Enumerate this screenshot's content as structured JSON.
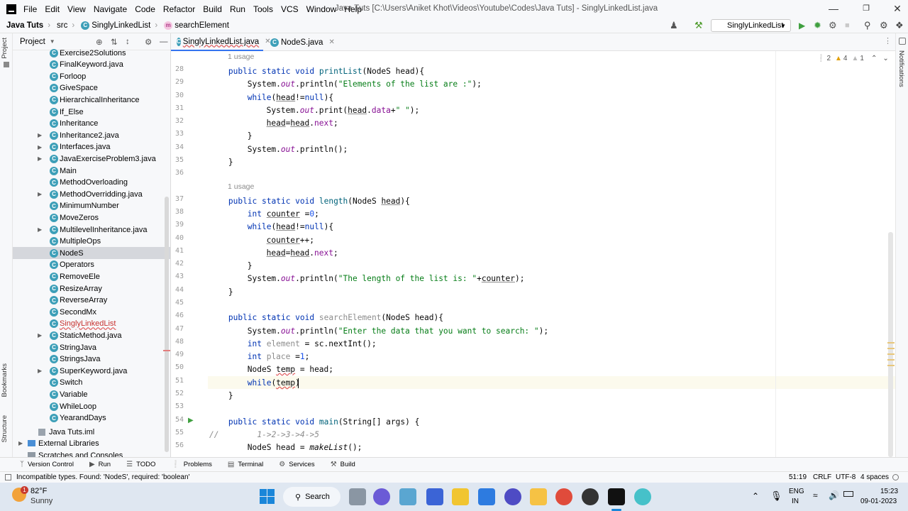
{
  "menubar": {
    "items": [
      "File",
      "Edit",
      "View",
      "Navigate",
      "Code",
      "Refactor",
      "Build",
      "Run",
      "Tools",
      "VCS",
      "Window",
      "Help"
    ],
    "title": "Java Tuts [C:\\Users\\Aniket Khot\\Videos\\Youtube\\Codes\\Java Tuts] - SinglyLinkedList.java"
  },
  "navbar": {
    "project": "Java Tuts",
    "src": "src",
    "cls": "SinglyLinkedList",
    "method": "searchElement",
    "run_config": "SinglyLinkedList"
  },
  "project_panel": {
    "title": "Project",
    "items": [
      {
        "name": "Exercise2Solutions",
        "arrow": false
      },
      {
        "name": "FinalKeyword.java",
        "arrow": false
      },
      {
        "name": "Forloop",
        "arrow": false
      },
      {
        "name": "GiveSpace",
        "arrow": false
      },
      {
        "name": "HierarchicalInheritance",
        "arrow": false
      },
      {
        "name": "If_Else",
        "arrow": false
      },
      {
        "name": "Inheritance",
        "arrow": false
      },
      {
        "name": "Inheritance2.java",
        "arrow": true
      },
      {
        "name": "Interfaces.java",
        "arrow": true
      },
      {
        "name": "JavaExerciseProblem3.java",
        "arrow": true
      },
      {
        "name": "Main",
        "arrow": false
      },
      {
        "name": "MethodOverloading",
        "arrow": false
      },
      {
        "name": "MethodOverridding.java",
        "arrow": true
      },
      {
        "name": "MinimumNumber",
        "arrow": false
      },
      {
        "name": "MoveZeros",
        "arrow": false
      },
      {
        "name": "MultilevelInheritance.java",
        "arrow": true
      },
      {
        "name": "MultipleOps",
        "arrow": false
      },
      {
        "name": "NodeS",
        "arrow": false,
        "selected": true
      },
      {
        "name": "Operators",
        "arrow": false
      },
      {
        "name": "RemoveEle",
        "arrow": false
      },
      {
        "name": "ResizeArray",
        "arrow": false
      },
      {
        "name": "ReverseArray",
        "arrow": false
      },
      {
        "name": "SecondMx",
        "arrow": false
      },
      {
        "name": "SinglyLinkedList",
        "arrow": false
      },
      {
        "name": "StaticMethod.java",
        "arrow": true
      },
      {
        "name": "StringJava",
        "arrow": false
      },
      {
        "name": "StringsJava",
        "arrow": false
      },
      {
        "name": "SuperKeyword.java",
        "arrow": true
      },
      {
        "name": "Switch",
        "arrow": false
      },
      {
        "name": "Variable",
        "arrow": false
      },
      {
        "name": "WhileLoop",
        "arrow": false
      },
      {
        "name": "YearandDays",
        "arrow": false
      }
    ],
    "iml": "Java Tuts.iml",
    "ext_libs": "External Libraries",
    "scratches": "Scratches and Consoles"
  },
  "tabs": [
    {
      "label": "SinglyLinkedList.java"
    },
    {
      "label": "NodeS.java"
    }
  ],
  "inspections": {
    "errors": "2",
    "warnings": "4",
    "weak": "1"
  },
  "code": {
    "usage1": "1 usage",
    "usage2": "1 usage",
    "line_numbers": [
      "28",
      "29",
      "30",
      "31",
      "32",
      "33",
      "34",
      "35",
      "36",
      "37",
      "38",
      "39",
      "40",
      "41",
      "42",
      "43",
      "44",
      "45",
      "46",
      "47",
      "48",
      "49",
      "50",
      "51",
      "52",
      "53",
      "54",
      "55",
      "56"
    ],
    "l28": [
      "public static void ",
      "printList",
      "(NodeS ",
      "head",
      "){"
    ],
    "l29": [
      "System.",
      "out",
      ".println(",
      "\"Elements of the list are :\"",
      ");"
    ],
    "l30": [
      "while",
      "(",
      "head",
      "!=",
      "null",
      "){"
    ],
    "l31": [
      "System.",
      "out",
      ".print(",
      "head",
      ".",
      "data",
      "+",
      "\" \"",
      ");"
    ],
    "l32": [
      "head",
      "=",
      "head",
      ".",
      "next",
      ";"
    ],
    "l33": "}",
    "l34": [
      "System.",
      "out",
      ".println();"
    ],
    "l35": "}",
    "l37": [
      "public static void ",
      "length",
      "(NodeS ",
      "head",
      "){"
    ],
    "l38": [
      "int ",
      "counter",
      " =",
      "0",
      ";"
    ],
    "l39": [
      "while",
      "(",
      "head",
      "!=",
      "null",
      "){"
    ],
    "l40": [
      "counter",
      "++;"
    ],
    "l41": [
      "head",
      "=",
      "head",
      ".",
      "next",
      ";"
    ],
    "l42": "}",
    "l43": [
      "System.",
      "out",
      ".println(",
      "\"The length of the list is: \"",
      "+",
      "counter",
      ");"
    ],
    "l44": "}",
    "l46": [
      "public static void ",
      "searchElement",
      "(NodeS head){"
    ],
    "l47": [
      "System.",
      "out",
      ".println(",
      "\"Enter the data that you want to search: \"",
      ");"
    ],
    "l48": [
      "int ",
      "element",
      " = sc.nextInt();"
    ],
    "l49": [
      "int ",
      "place",
      " =",
      "1",
      ";"
    ],
    "l50": [
      "NodeS ",
      "temp",
      " = head;"
    ],
    "l51": [
      "while",
      "(",
      "temp",
      ")"
    ],
    "l52": "}",
    "l54": [
      "public static void ",
      "main",
      "(String[] args) {"
    ],
    "l55": [
      "//",
      "        1->2->3->4->5"
    ],
    "l56": [
      "NodeS head = ",
      "makeList",
      "();"
    ]
  },
  "bottom_tools": [
    "Version Control",
    "Run",
    "TODO",
    "Problems",
    "Terminal",
    "Services",
    "Build"
  ],
  "status": {
    "message": "Incompatible types. Found: 'NodeS', required: 'boolean'",
    "position": "51:19",
    "line_sep": "CRLF",
    "encoding": "UTF-8",
    "indent": "4 spaces"
  },
  "sidebars": {
    "project": "Project",
    "bookmarks": "Bookmarks",
    "structure": "Structure",
    "notifications": "Notifications"
  },
  "taskbar": {
    "temp": "82°F",
    "weather": "Sunny",
    "search": "Search",
    "lang1": "ENG",
    "lang2": "IN",
    "time": "15:23",
    "date": "09-01-2023",
    "badge": "1"
  }
}
